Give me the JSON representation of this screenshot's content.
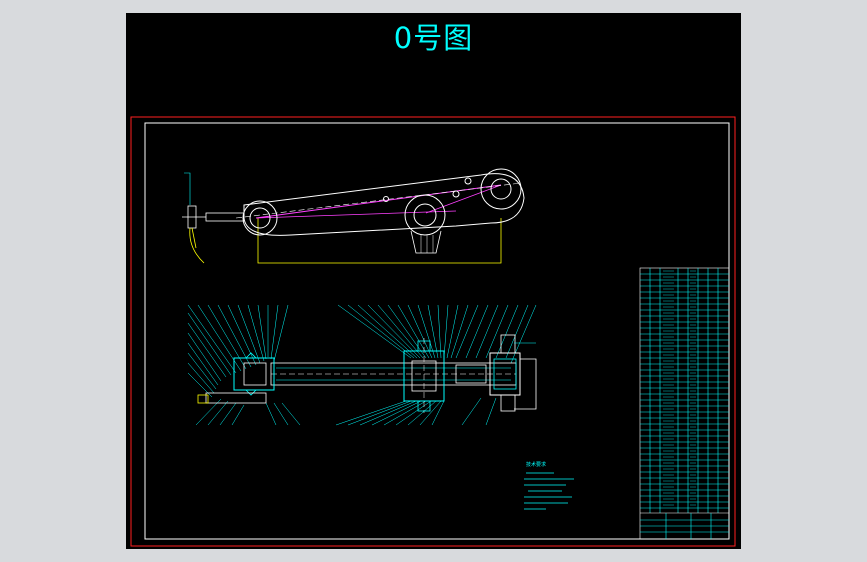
{
  "sheet": {
    "title": "0号图",
    "tech_requirements_heading": "技术要求",
    "line_colors": {
      "red": "#ff2020",
      "white": "#ffffff",
      "cyan": "#00ffff",
      "yellow": "#ffff00",
      "magenta": "#ff40ff",
      "green": "#00ff00"
    }
  }
}
